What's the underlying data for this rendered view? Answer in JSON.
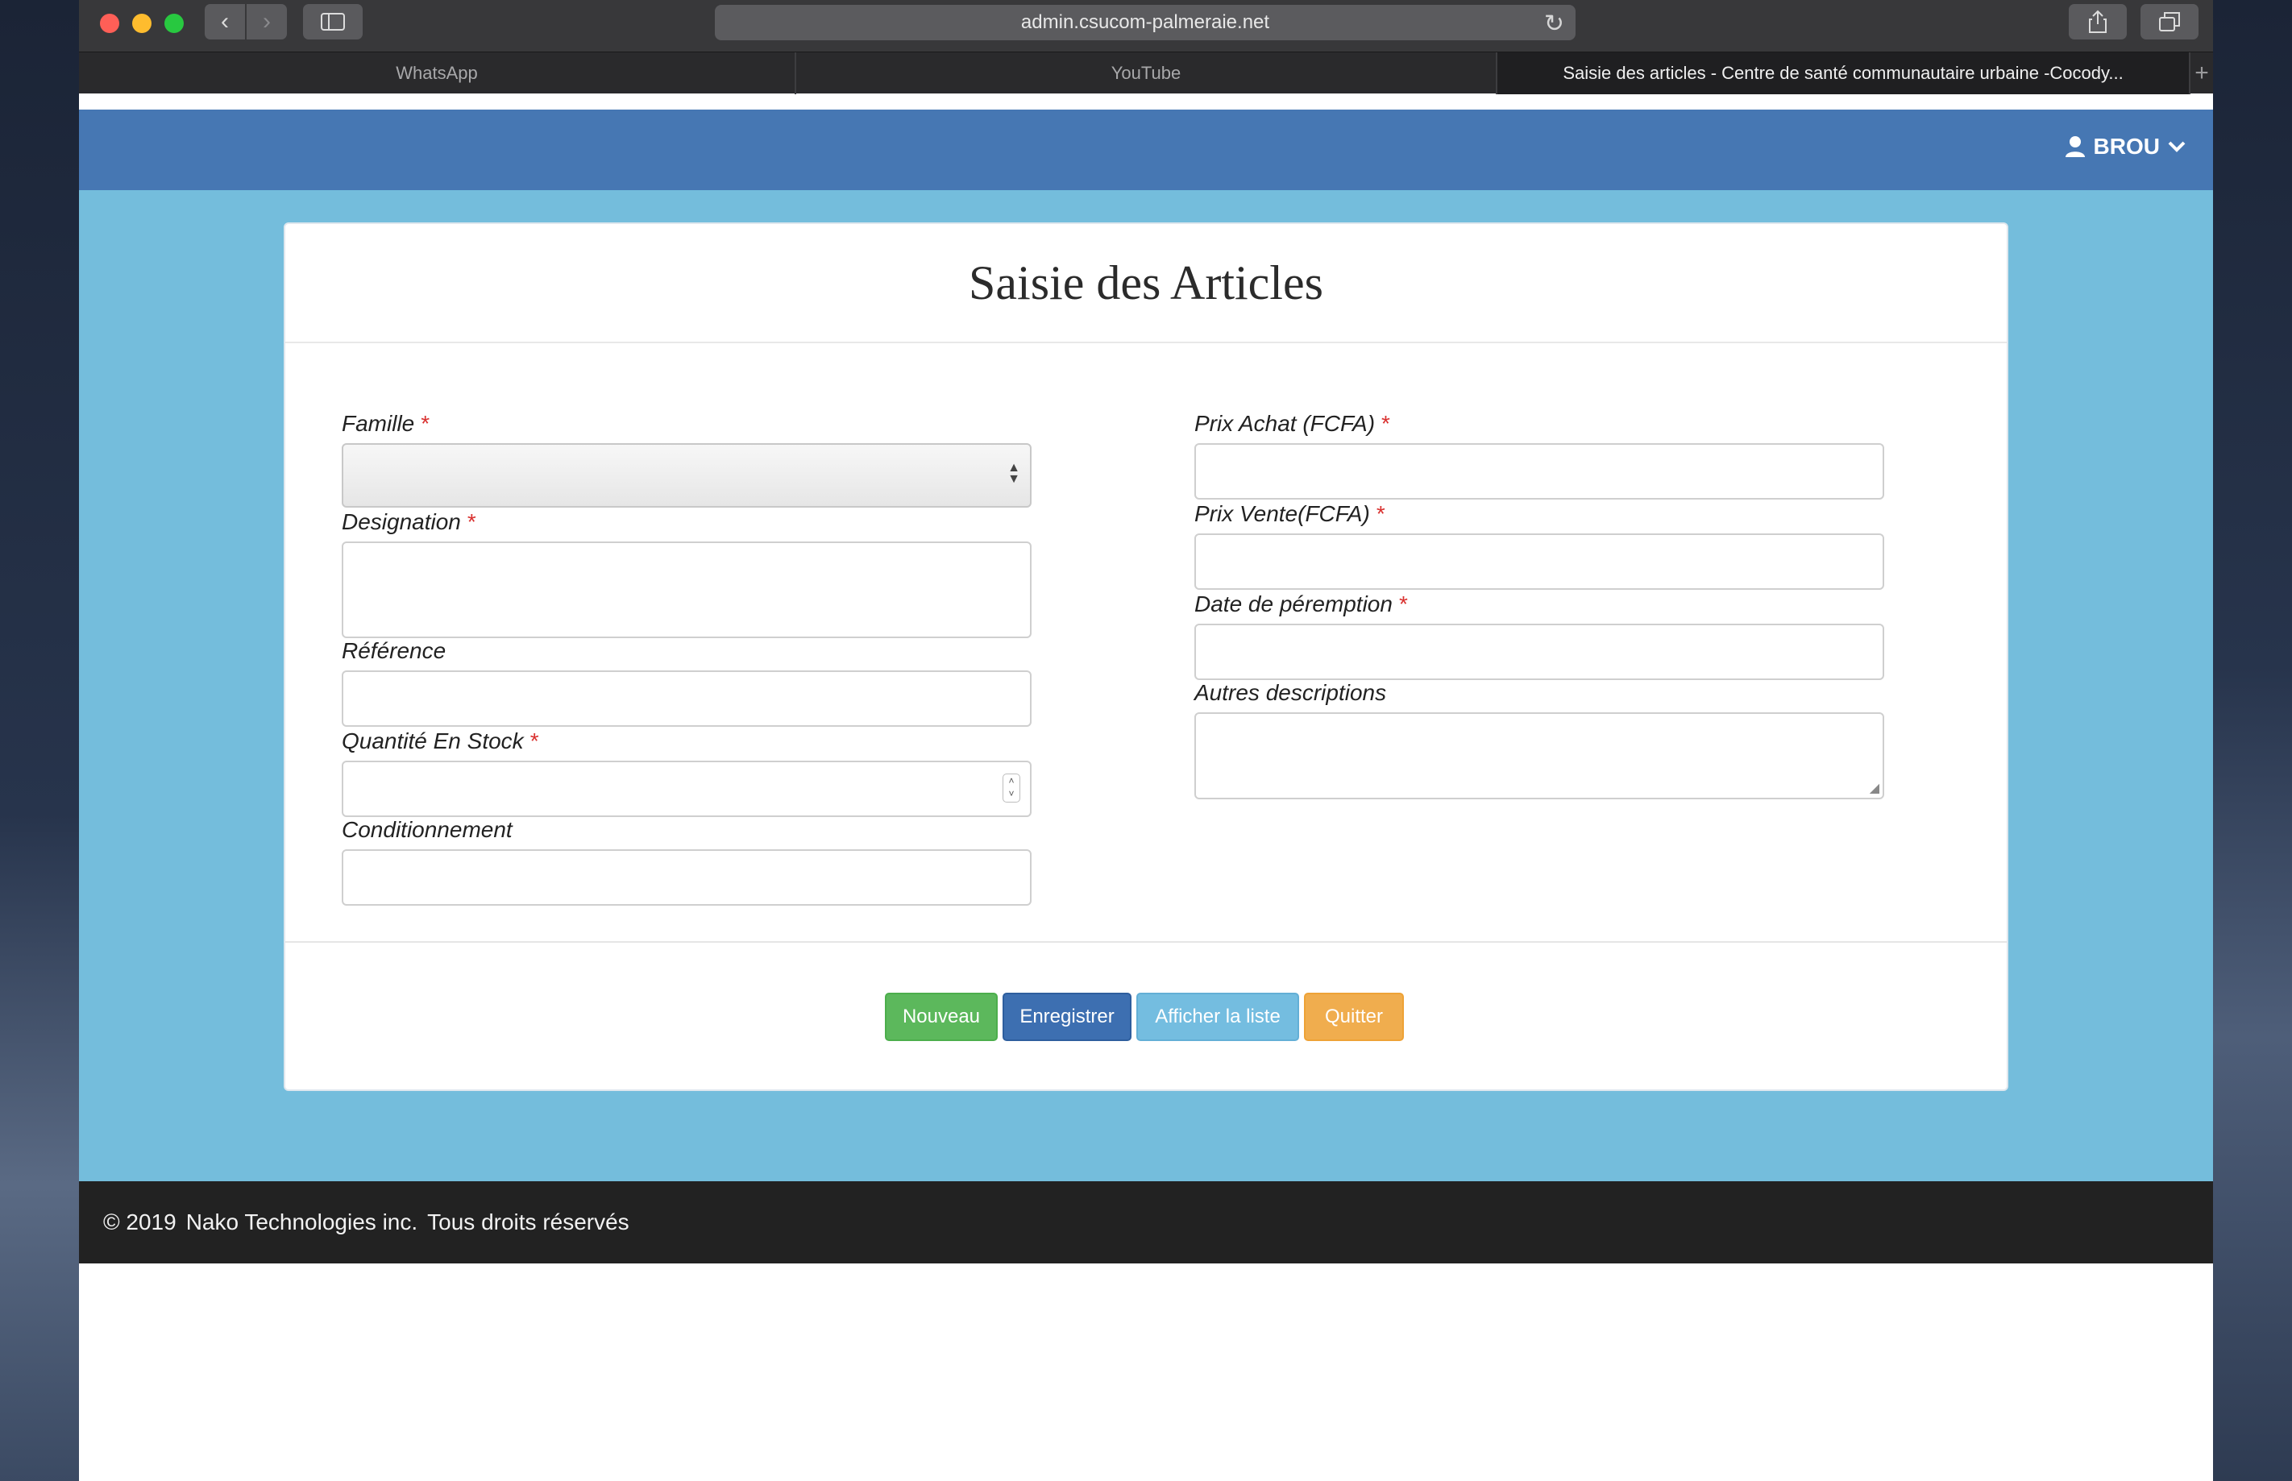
{
  "browser": {
    "url": "admin.csucom-palmeraie.net",
    "tabs": [
      {
        "label": "WhatsApp"
      },
      {
        "label": "YouTube"
      },
      {
        "label": "Saisie des articles - Centre de santé communautaire urbaine -Cocody..."
      }
    ]
  },
  "navbar": {
    "user": "BROU"
  },
  "form": {
    "title": "Saisie des Articles",
    "required_mark": "*",
    "left": {
      "famille": "Famille",
      "designation": "Designation",
      "reference": "Référence",
      "quantite": "Quantité En Stock",
      "conditionnement": "Conditionnement"
    },
    "right": {
      "prix_achat": "Prix Achat (FCFA)",
      "prix_vente": "Prix Vente(FCFA)",
      "date_peremption": "Date de péremption",
      "autres": "Autres descriptions"
    },
    "buttons": {
      "nouveau": "Nouveau",
      "enregistrer": "Enregistrer",
      "afficher": "Afficher la liste",
      "quitter": "Quitter"
    }
  },
  "footer": {
    "copyright": "© 2019",
    "company": "Nako Technologies inc.",
    "rights": "Tous droits réservés"
  },
  "colors": {
    "navbar": "#4677b3",
    "content_bg": "#74bddc",
    "footer": "#222222",
    "btn_nouveau": "#5cb85c",
    "btn_enregistrer": "#3d6fb1",
    "btn_afficher": "#74bde0",
    "btn_quitter": "#f0ad4e"
  }
}
